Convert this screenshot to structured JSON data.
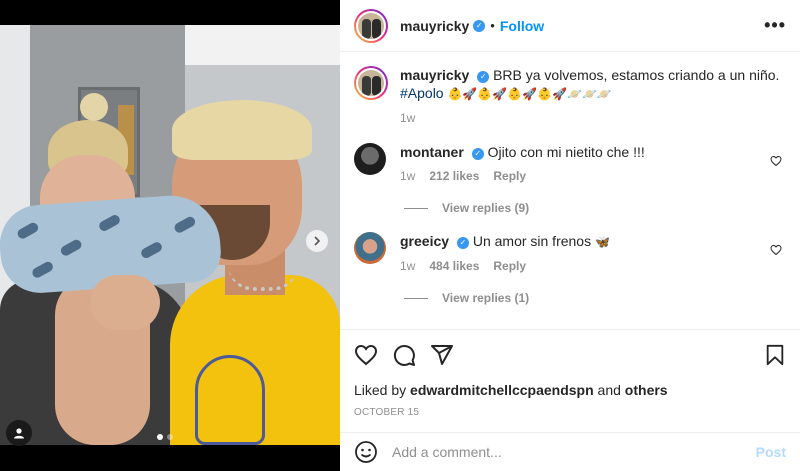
{
  "post": {
    "author": "mauyricky",
    "follow_label": "Follow",
    "separator": "•",
    "more_icon": "more-options-icon"
  },
  "caption": {
    "username": "mauyricky",
    "text": "BRB ya volvemos, estamos criando a un niño.",
    "hashtag": "#Apolo",
    "emojis": "👶🚀👶🚀👶🚀👶🚀🪐🪐🪐",
    "time": "1w"
  },
  "comments": [
    {
      "username": "montaner",
      "text": "Ojito con mi nietito che !!!",
      "time": "1w",
      "likes": "212 likes",
      "reply_label": "Reply",
      "view_replies": "View replies (9)"
    },
    {
      "username": "greeicy",
      "text": "Un amor sin frenos",
      "emoji": "🦋",
      "time": "1w",
      "likes": "484 likes",
      "reply_label": "Reply",
      "view_replies": "View replies (1)"
    }
  ],
  "footer": {
    "liked_prefix": "Liked by",
    "liked_user": "edwardmitchellccpaendspn",
    "liked_and": "and",
    "liked_others": "others",
    "date": "OCTOBER 15",
    "comment_placeholder": "Add a comment...",
    "post_label": "Post"
  },
  "carousel": {
    "total": 2,
    "active_index": 0
  },
  "colors": {
    "accent": "#0095f6",
    "verified": "#3897f0",
    "muted": "#8e8e8e",
    "post_disabled": "#b3dbff"
  }
}
